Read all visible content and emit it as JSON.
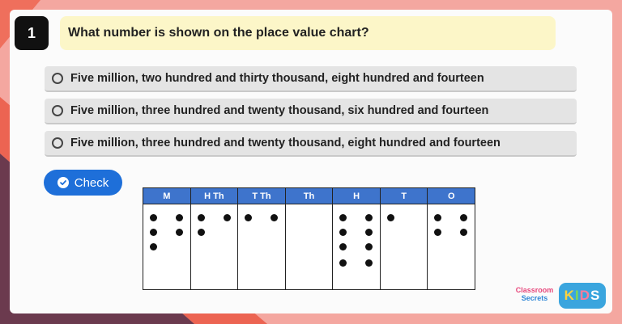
{
  "question": {
    "number": "1",
    "text": "What number is shown on the place value chart?"
  },
  "options": [
    {
      "label": "Five million, two hundred and thirty thousand, eight hundred and fourteen"
    },
    {
      "label": "Five million, three hundred and twenty thousand, six hundred and fourteen"
    },
    {
      "label": "Five million, three hundred and twenty thousand, eight hundred and fourteen"
    }
  ],
  "check_button": {
    "label": "Check",
    "icon": "check-circle-icon"
  },
  "place_value_chart": {
    "columns": [
      {
        "header": "M",
        "counters": 5
      },
      {
        "header": "H Th",
        "counters": 3
      },
      {
        "header": "T Th",
        "counters": 2
      },
      {
        "header": "Th",
        "counters": 0
      },
      {
        "header": "H",
        "counters": 8
      },
      {
        "header": "T",
        "counters": 1
      },
      {
        "header": "O",
        "counters": 4
      }
    ]
  },
  "logos": {
    "classroom_secrets": [
      "Classroom",
      "Secrets"
    ],
    "kids": [
      "K",
      "I",
      "D",
      "S"
    ]
  },
  "colors": {
    "header_blue": "#3e74cc",
    "button_blue": "#1e6fd9",
    "question_bg": "#fcf6c8"
  }
}
